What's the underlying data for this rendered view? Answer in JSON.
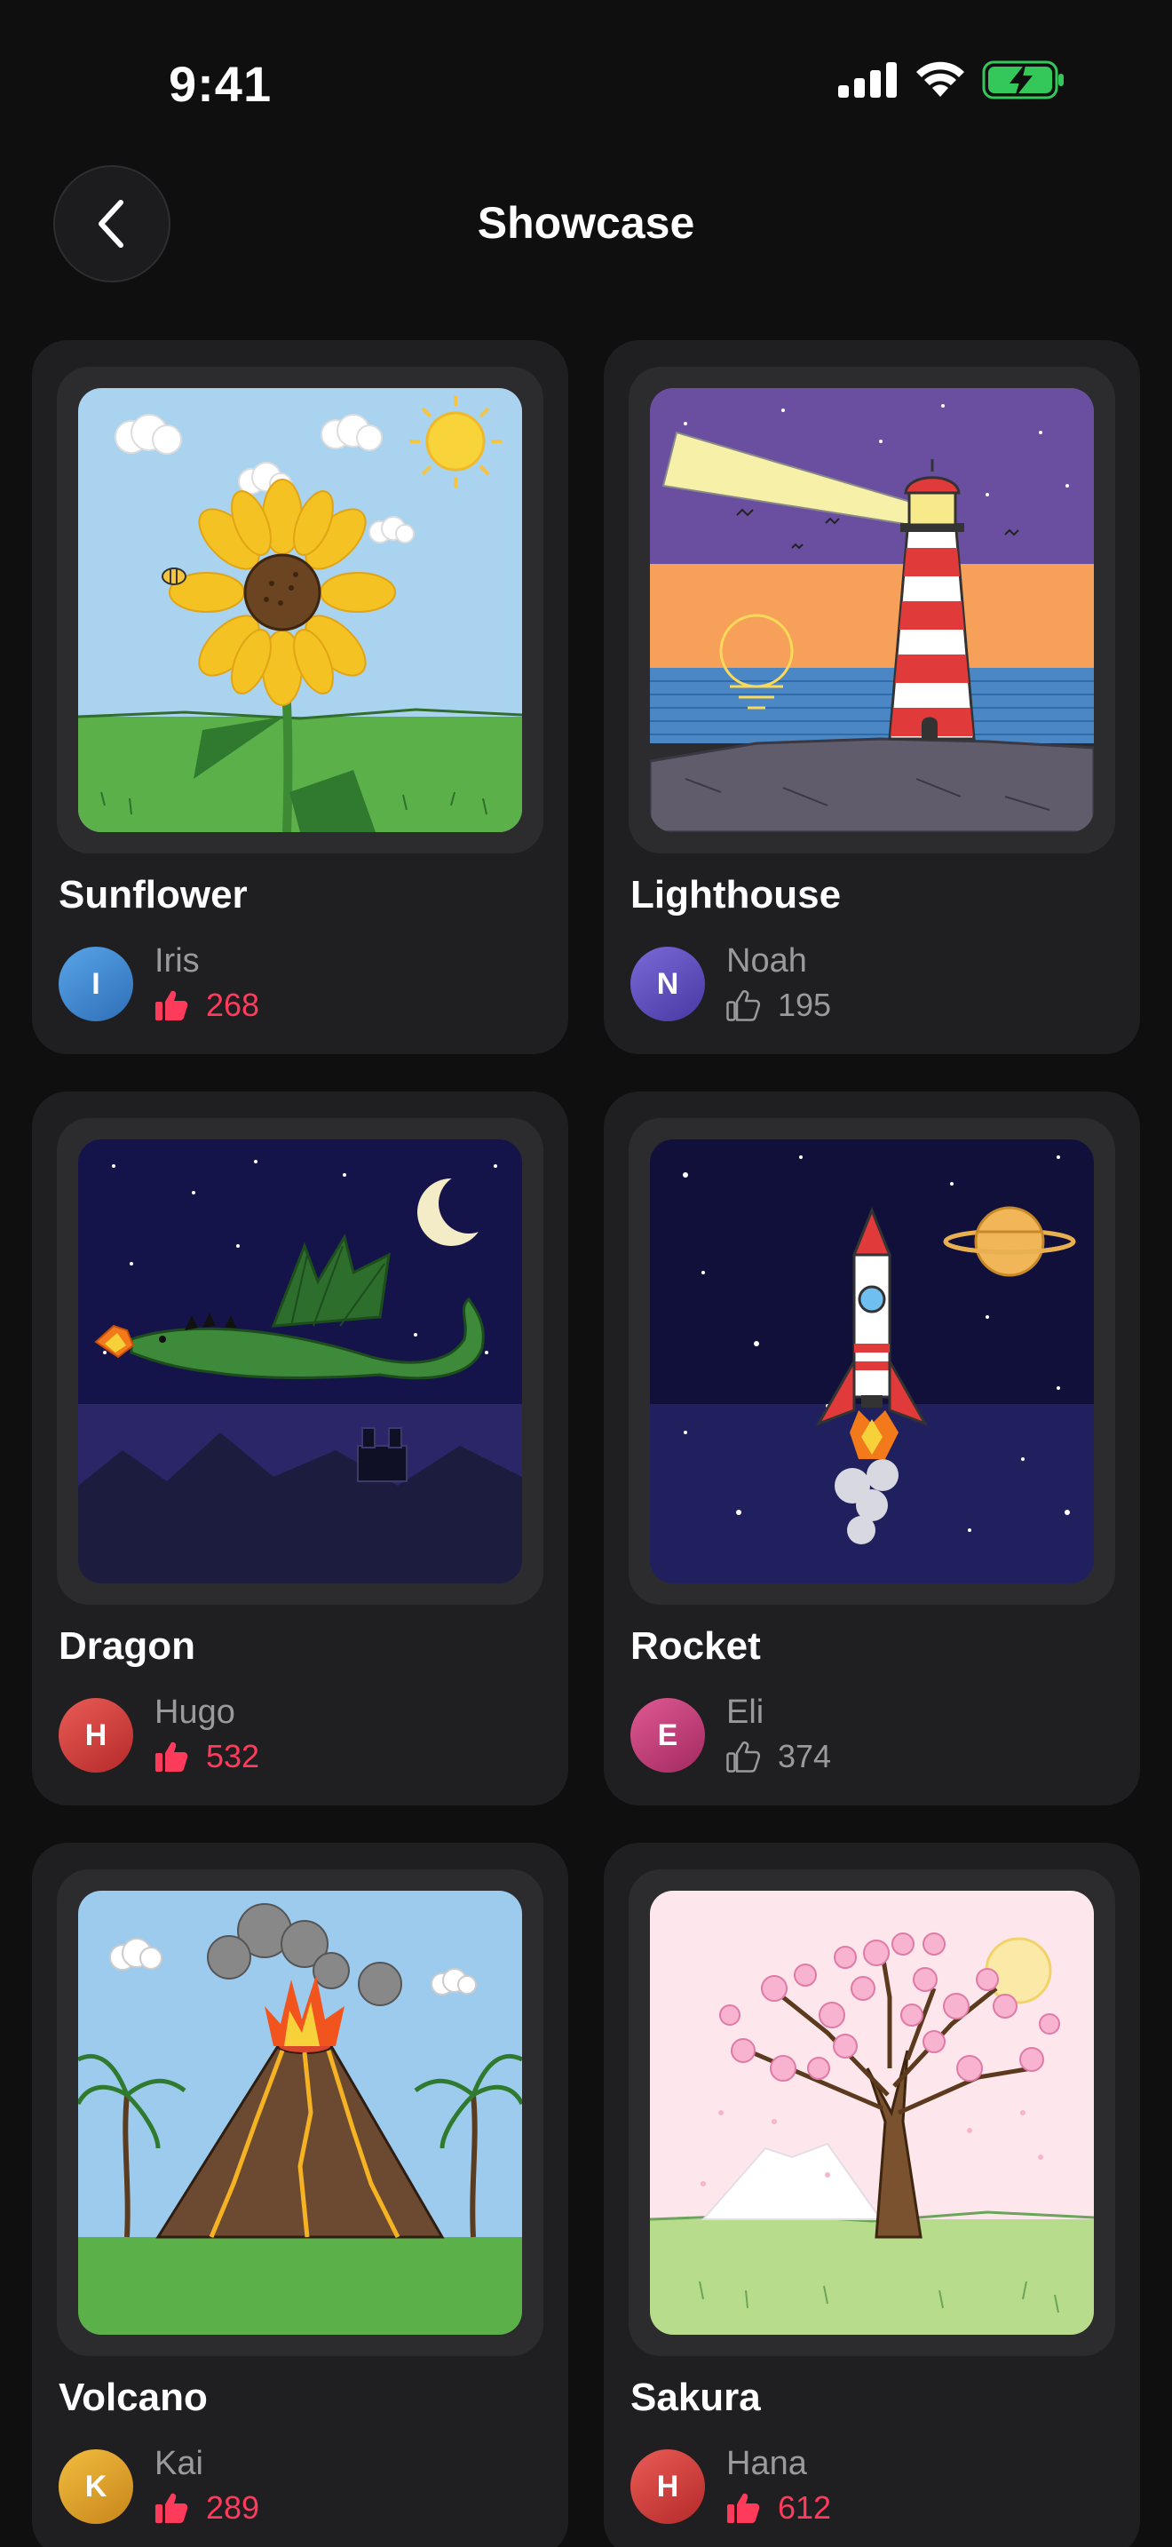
{
  "status_bar": {
    "time": "9:41"
  },
  "nav": {
    "title": "Showcase"
  },
  "colors": {
    "like_active": "#ff3b5c",
    "background": "#0f0f10",
    "card": "#1f1f21"
  },
  "cards": [
    {
      "title": "Sunflower",
      "author": "Iris",
      "initial": "I",
      "likes": "268",
      "liked": true,
      "avatar_color": "#3f82c9"
    },
    {
      "title": "Lighthouse",
      "author": "Noah",
      "initial": "N",
      "likes": "195",
      "liked": false,
      "avatar_color": "#5b4bb8"
    },
    {
      "title": "Dragon",
      "author": "Hugo",
      "initial": "H",
      "likes": "532",
      "liked": true,
      "avatar_color": "#d9403f"
    },
    {
      "title": "Rocket",
      "author": "Eli",
      "initial": "E",
      "likes": "374",
      "liked": false,
      "avatar_color": "#c83a78"
    },
    {
      "title": "Volcano",
      "author": "Kai",
      "initial": "K",
      "likes": "289",
      "liked": true,
      "avatar_color": "#e0a32a"
    },
    {
      "title": "Sakura",
      "author": "Hana",
      "initial": "H",
      "likes": "612",
      "liked": true,
      "avatar_color": "#d9403f"
    }
  ]
}
